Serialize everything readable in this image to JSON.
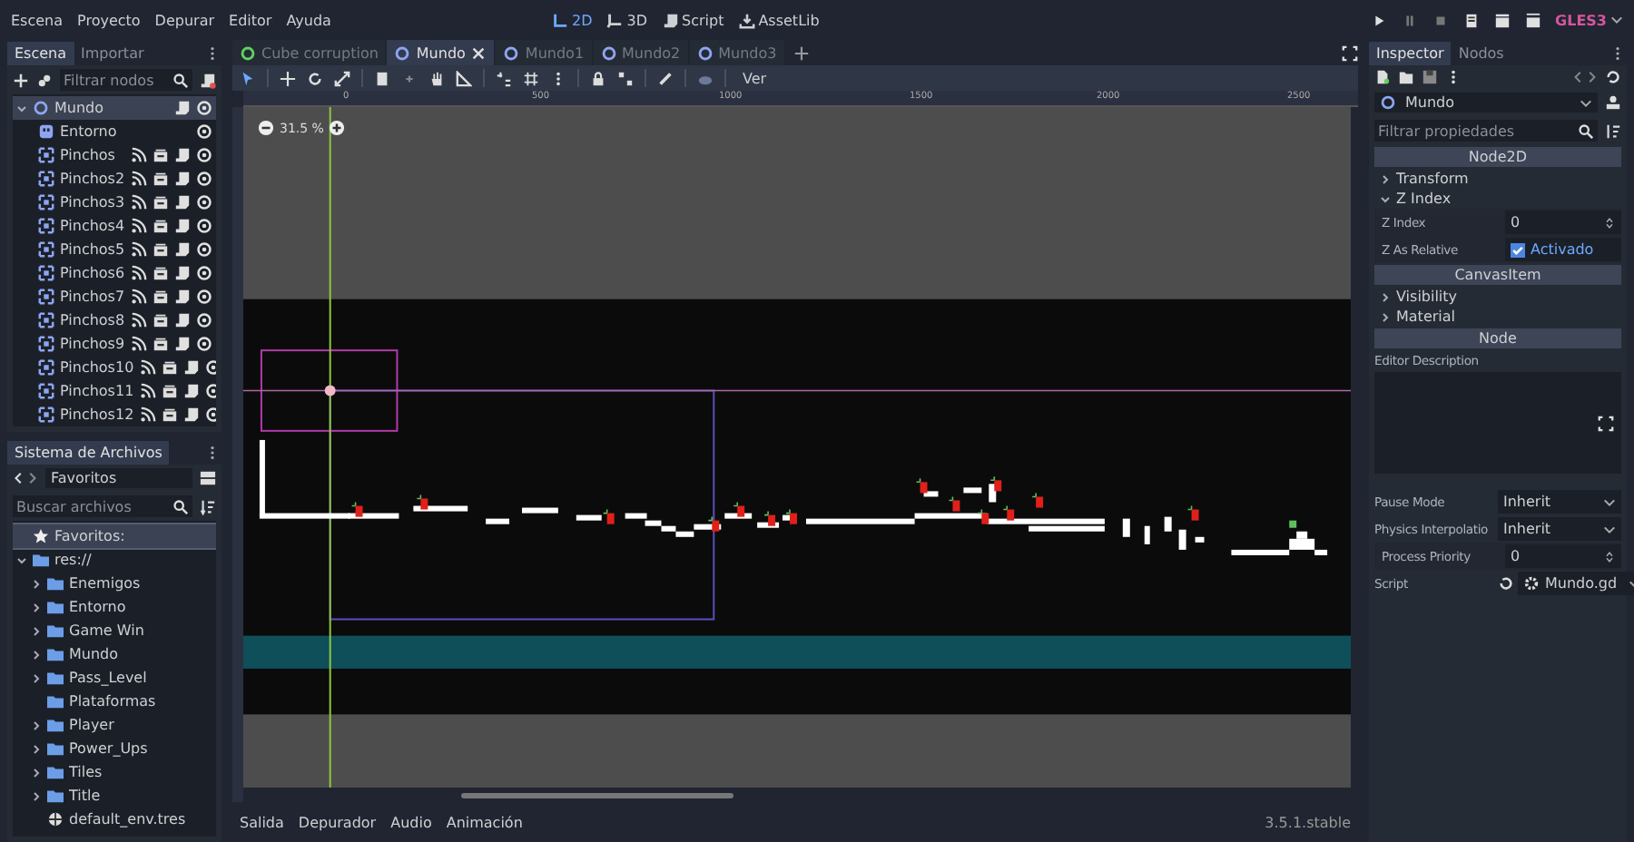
{
  "menu": [
    "Escena",
    "Proyecto",
    "Depurar",
    "Editor",
    "Ayuda"
  ],
  "workspaces": [
    {
      "label": "2D",
      "kind": "planar",
      "selected": true
    },
    {
      "label": "3D",
      "kind": "spatial",
      "selected": false
    },
    {
      "label": "Script",
      "kind": "script",
      "selected": false
    },
    {
      "label": "AssetLib",
      "kind": "assetlib",
      "selected": false
    }
  ],
  "renderer": "GLES3",
  "scene_dock": {
    "tabs": [
      {
        "label": "Escena",
        "selected": true
      },
      {
        "label": "Importar",
        "selected": false
      }
    ],
    "filter_placeholder": "Filtrar nodos",
    "tree": {
      "name": "Mundo",
      "kind": "node2d",
      "selected": true,
      "expanded": true,
      "children": [
        {
          "name": "Entorno",
          "kind": "tilemap",
          "selected": false
        },
        {
          "name": "Pinchos",
          "kind": "area",
          "selected": false
        },
        {
          "name": "Pinchos2",
          "kind": "area",
          "selected": false
        },
        {
          "name": "Pinchos3",
          "kind": "area",
          "selected": false
        },
        {
          "name": "Pinchos4",
          "kind": "area",
          "selected": false
        },
        {
          "name": "Pinchos5",
          "kind": "area",
          "selected": false
        },
        {
          "name": "Pinchos6",
          "kind": "area",
          "selected": false
        },
        {
          "name": "Pinchos7",
          "kind": "area",
          "selected": false
        },
        {
          "name": "Pinchos8",
          "kind": "area",
          "selected": false
        },
        {
          "name": "Pinchos9",
          "kind": "area",
          "selected": false
        },
        {
          "name": "Pinchos10",
          "kind": "area",
          "selected": false
        },
        {
          "name": "Pinchos11",
          "kind": "area",
          "selected": false
        },
        {
          "name": "Pinchos12",
          "kind": "area",
          "selected": false
        }
      ]
    }
  },
  "filesystem": {
    "title": "Sistema de Archivos",
    "path": "Favoritos",
    "search_placeholder": "Buscar archivos",
    "items": [
      {
        "name": "Favoritos:",
        "kind": "favorites",
        "selected": true
      },
      {
        "name": "res://",
        "kind": "folder",
        "selected": false,
        "expandable": true,
        "expanded": true,
        "children": [
          {
            "name": "Enemigos",
            "kind": "folder",
            "selected": false,
            "expandable": true,
            "expanded": false
          },
          {
            "name": "Entorno",
            "kind": "folder",
            "selected": false,
            "expandable": true,
            "expanded": false
          },
          {
            "name": "Game Win",
            "kind": "folder",
            "selected": false,
            "expandable": true,
            "expanded": false
          },
          {
            "name": "Mundo",
            "kind": "folder",
            "selected": false,
            "expandable": true,
            "expanded": false
          },
          {
            "name": "Pass_Level",
            "kind": "folder",
            "selected": false,
            "expandable": true,
            "expanded": false
          },
          {
            "name": "Plataformas",
            "kind": "folder",
            "selected": false,
            "expandable": false
          },
          {
            "name": "Player",
            "kind": "folder",
            "selected": false,
            "expandable": true,
            "expanded": false
          },
          {
            "name": "Power_Ups",
            "kind": "folder",
            "selected": false,
            "expandable": true,
            "expanded": false
          },
          {
            "name": "Tiles",
            "kind": "folder",
            "selected": false,
            "expandable": true,
            "expanded": false
          },
          {
            "name": "Title",
            "kind": "folder",
            "selected": false,
            "expandable": true,
            "expanded": false
          },
          {
            "name": "default_env.tres",
            "kind": "file",
            "selected": false
          }
        ]
      }
    ]
  },
  "editor_tabs": [
    {
      "label": "Cube corruption",
      "color": "#5fd35f",
      "selected": false
    },
    {
      "label": "Mundo",
      "color": "#8da5f3",
      "selected": true
    },
    {
      "label": "Mundo1",
      "color": "#8da5f3",
      "selected": false
    },
    {
      "label": "Mundo2",
      "color": "#8da5f3",
      "selected": false
    },
    {
      "label": "Mundo3",
      "color": "#8da5f3",
      "selected": false
    }
  ],
  "toolbar": {
    "view_menu": "Ver"
  },
  "ruler": {
    "labels": [
      "0",
      "500",
      "1000",
      "1500",
      "2000",
      "2500"
    ]
  },
  "zoom": "31.5 %",
  "bottom_tabs": [
    "Salida",
    "Depurador",
    "Audio",
    "Animación"
  ],
  "version": "3.5.1.stable",
  "inspector": {
    "tabs": [
      {
        "label": "Inspector",
        "selected": true
      },
      {
        "label": "Nodos",
        "selected": false
      }
    ],
    "node": "Mundo",
    "filter_placeholder": "Filtrar propiedades",
    "rows": [
      {
        "kind": "category",
        "label": "Node2D"
      },
      {
        "kind": "group",
        "label": "Transform",
        "expanded": false
      },
      {
        "kind": "group",
        "label": "Z Index",
        "expanded": true
      },
      {
        "kind": "spin",
        "label": "Z Index",
        "value": "0"
      },
      {
        "kind": "check",
        "label": "Z As Relative",
        "value": "Activado",
        "checked": true
      },
      {
        "kind": "category",
        "label": "CanvasItem"
      },
      {
        "kind": "group",
        "label": "Visibility",
        "expanded": false
      },
      {
        "kind": "group",
        "label": "Material",
        "expanded": false
      },
      {
        "kind": "category",
        "label": "Node"
      },
      {
        "kind": "textarea",
        "label": "Editor Description"
      },
      {
        "kind": "dropdown",
        "label": "Pause Mode",
        "value": "Inherit"
      },
      {
        "kind": "dropdown",
        "label": "Physics Interpolatio",
        "value": "Inherit"
      },
      {
        "kind": "spin",
        "label": "Process Priority",
        "value": "0"
      },
      {
        "kind": "script",
        "label": "Script",
        "value": "Mundo.gd"
      }
    ]
  }
}
